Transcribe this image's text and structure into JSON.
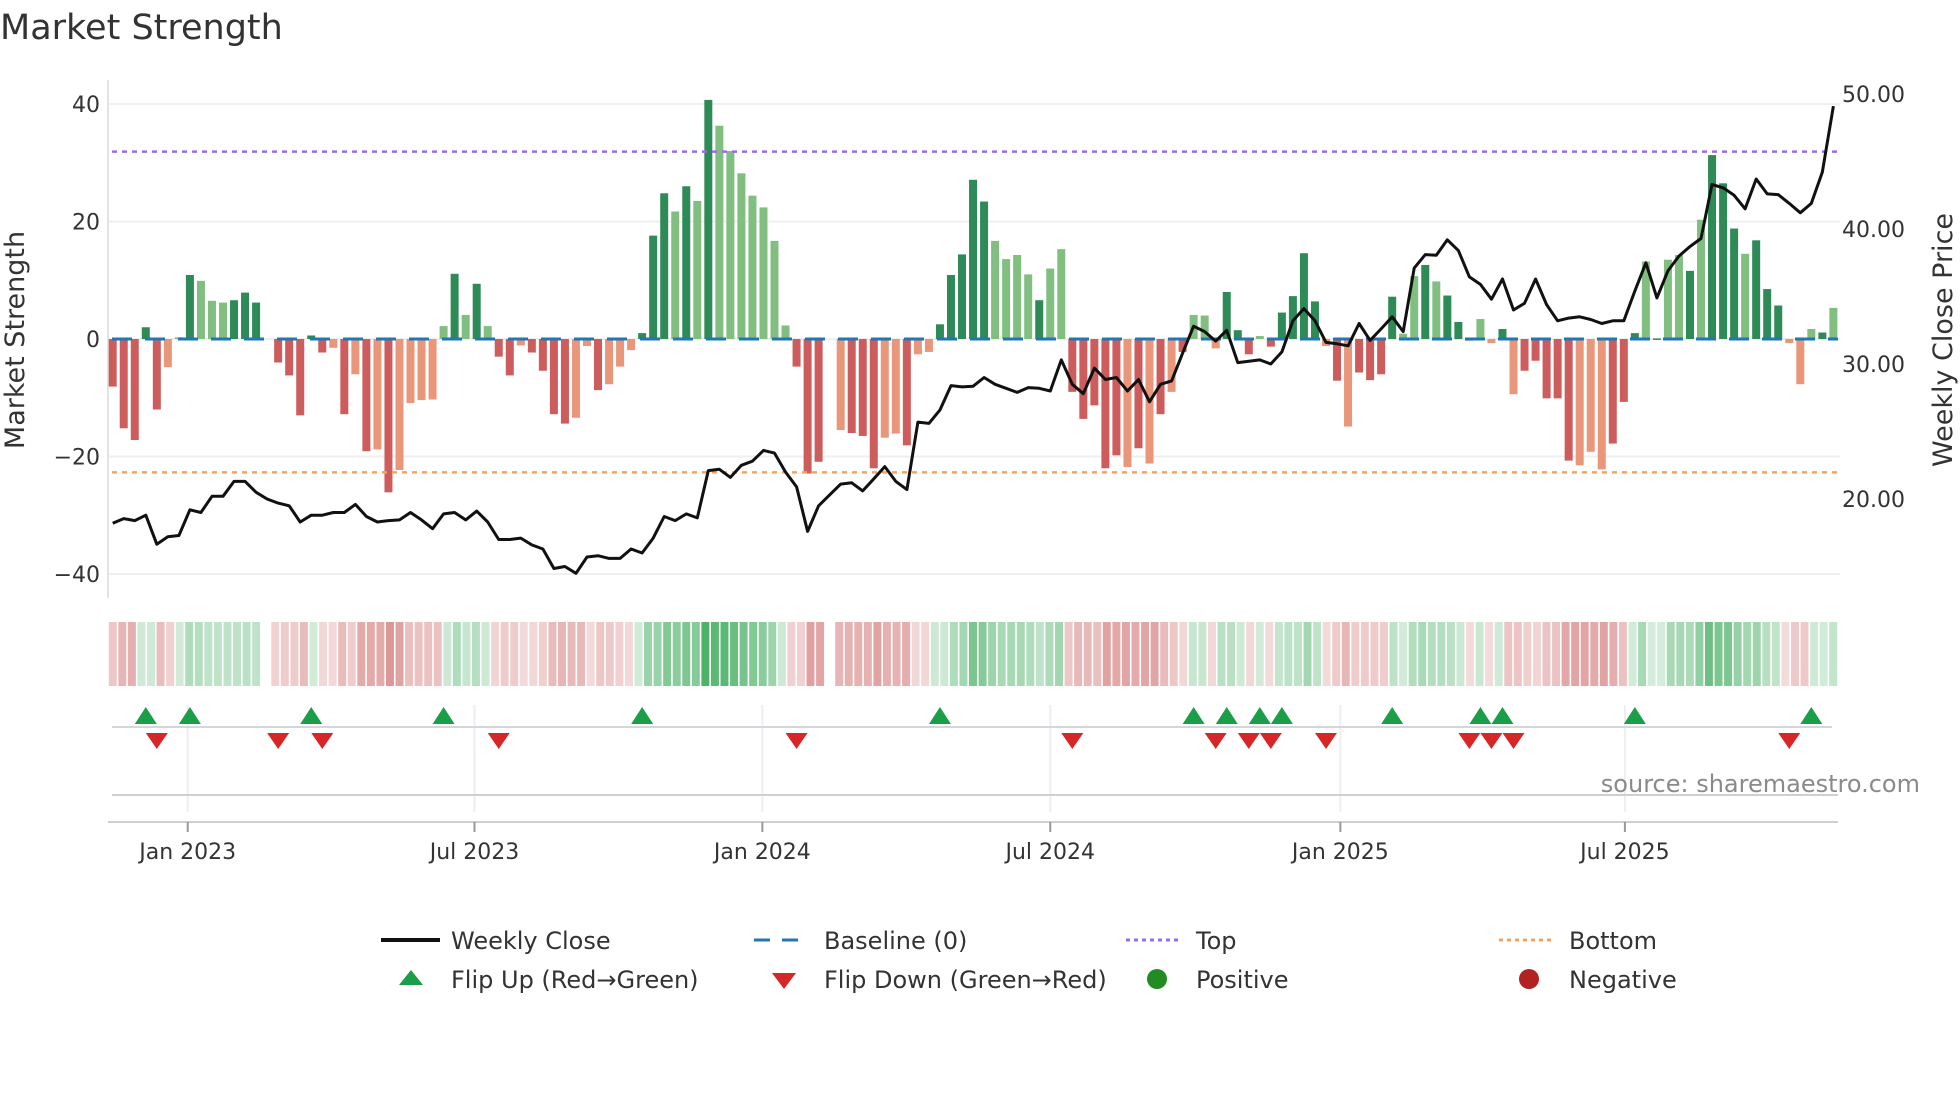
{
  "title": "Market Strength",
  "source": "source: sharemaestro.com",
  "legend": {
    "weekly_close": "Weekly Close",
    "baseline": "Baseline (0)",
    "top": "Top",
    "bottom": "Bottom",
    "flip_up": "Flip Up (Red→Green)",
    "flip_down": "Flip Down (Green→Red)",
    "positive": "Positive",
    "negative": "Negative"
  },
  "colors": {
    "strong_green": "#2e8b57",
    "weak_green": "#80bf80",
    "strong_red": "#cd5c5c",
    "weak_red": "#e9967a",
    "heat_green": "#3caa5a",
    "heat_red": "#cd6464",
    "close_line": "#111111",
    "baseline": "#1f77b4",
    "top": "#9b6ee0",
    "bottom": "#f4a460",
    "flip_up": "#1a9e48",
    "flip_down": "#d62728",
    "positive": "#228b22",
    "negative": "#b22222"
  },
  "chart_data": {
    "type": "bar",
    "title": "Market Strength",
    "ylabel": "Market Strength",
    "y2label": "Weekly Close Price",
    "xlabel": "",
    "ylim": [
      -44,
      44
    ],
    "y2lim": [
      12.6,
      50.9
    ],
    "left_ticks": [
      {
        "value": 40,
        "label": "40"
      },
      {
        "value": 20,
        "label": "20"
      },
      {
        "value": 0,
        "label": "0"
      },
      {
        "value": -20,
        "label": "−20"
      },
      {
        "value": -40,
        "label": "−40"
      }
    ],
    "right_ticks": [
      {
        "value": 50,
        "label": "50.00"
      },
      {
        "value": 40,
        "label": "40.00"
      },
      {
        "value": 30,
        "label": "30.00"
      },
      {
        "value": 20,
        "label": "20.00"
      }
    ],
    "x_ticks": [
      {
        "week": 7.8,
        "label": "Jan 2023"
      },
      {
        "week": 33.8,
        "label": "Jul 2023"
      },
      {
        "week": 59.9,
        "label": "Jan 2024"
      },
      {
        "week": 86.0,
        "label": "Jul 2024"
      },
      {
        "week": 112.3,
        "label": "Jan 2025"
      },
      {
        "week": 138.1,
        "label": "Jul 2025"
      }
    ],
    "top_level": 31.9,
    "bottom_level": -22.7,
    "baseline": 0,
    "strength": [
      -8.1,
      -15.2,
      -17.2,
      2.0,
      -12,
      -4.8,
      0.3,
      10.9,
      9.9,
      6.5,
      6.2,
      6.6,
      7.9,
      6.2,
      0,
      -4,
      -6.2,
      -13,
      0.6,
      -2.3,
      -1.5,
      -12.8,
      -6,
      -19.1,
      -18.8,
      -26.1,
      -22.3,
      -10.9,
      -10.4,
      -10.3,
      2.2,
      11.1,
      4.1,
      9.4,
      2.2,
      -3,
      -6.2,
      -1.1,
      -2.3,
      -5.4,
      -12.8,
      -14.4,
      -13.4,
      -1.2,
      -8.7,
      -7.7,
      -4.7,
      -1.9,
      1.0,
      17.6,
      24.8,
      21.7,
      26,
      23.5,
      40.7,
      36.3,
      32,
      28.2,
      24.4,
      22.4,
      16.7,
      2.3,
      -4.7,
      -22.9,
      -20.9,
      0,
      -15.5,
      -16,
      -16.5,
      -22,
      -16.8,
      -16.1,
      -18.1,
      -2.6,
      -2.2,
      2.5,
      10.9,
      14.4,
      27.1,
      23.4,
      16.7,
      13.6,
      14.3,
      11,
      6.6,
      12,
      15.3,
      -9,
      -13.6,
      -11.3,
      -22,
      -19.8,
      -21.8,
      -18.6,
      -21.2,
      -12.8,
      -9,
      -2.2,
      4.1,
      4.0,
      -1.6,
      8,
      1.5,
      -2.6,
      0.5,
      -1.3,
      4.5,
      7.3,
      14.6,
      6.4,
      -1.2,
      -7.1,
      -14.9,
      -5.7,
      -7,
      -6,
      7.2,
      0.9,
      10.7,
      12.6,
      9.8,
      7.4,
      2.9,
      -0.3,
      3.4,
      -0.7,
      1.7,
      -9.4,
      -5.4,
      -3.7,
      -10.1,
      -10.1,
      -20.7,
      -21.5,
      -19.2,
      -22.2,
      -17.8,
      -10.7,
      1.0,
      13.2,
      0.1,
      13.5,
      14.3,
      11.6,
      20.3,
      31.3,
      26.5,
      18.8,
      14.5,
      16.8,
      8.5,
      5.7,
      -0.7,
      -7.7,
      1.7,
      1.1,
      5.3
    ],
    "shade": "dddddlldllldddldddddldldldllllldldlddlddddlldllldddldldllllllldddlldddlldlldddddlllldlldddddldldldllldddldddddldlddddlldlddllldldddddllldddldlldldddldddllldldllllddddlldd",
    "weekly_close": [
      18.2,
      18.55,
      18.4,
      18.8,
      16.65,
      17.2,
      17.3,
      19.2,
      19.0,
      20.2,
      20.2,
      21.3,
      21.3,
      20.5,
      20.0,
      19.7,
      19.5,
      18.3,
      18.8,
      18.8,
      19.0,
      19.0,
      19.6,
      18.7,
      18.3,
      18.4,
      18.45,
      19.0,
      18.45,
      17.8,
      18.9,
      19.0,
      18.45,
      19.1,
      18.3,
      17.0,
      17.0,
      17.1,
      16.6,
      16.3,
      14.85,
      15.0,
      14.5,
      15.7,
      15.8,
      15.6,
      15.6,
      16.3,
      16.0,
      17.1,
      18.7,
      18.4,
      18.9,
      18.6,
      22.1,
      22.2,
      21.6,
      22.5,
      22.8,
      23.6,
      23.4,
      22.0,
      20.9,
      17.6,
      19.5,
      20.3,
      21.1,
      21.2,
      20.6,
      21.5,
      22.4,
      21.3,
      20.7,
      25.7,
      25.6,
      26.6,
      28.4,
      28.3,
      28.35,
      29.0,
      28.5,
      28.2,
      27.9,
      28.25,
      28.2,
      28.0,
      30.3,
      28.5,
      27.8,
      29.7,
      28.85,
      29.0,
      28.0,
      28.85,
      27.2,
      28.5,
      28.75,
      30.8,
      32.8,
      32.4,
      31.7,
      32.5,
      30.1,
      30.2,
      30.3,
      30.0,
      30.9,
      33.2,
      34.1,
      33.2,
      31.6,
      31.5,
      31.35,
      33.0,
      31.75,
      32.6,
      33.5,
      32.4,
      37.1,
      38.1,
      38.05,
      39.2,
      38.4,
      36.45,
      35.9,
      34.8,
      36.3,
      34.0,
      34.5,
      36.3,
      34.4,
      33.2,
      33.4,
      33.5,
      33.3,
      33.0,
      33.2,
      33.2,
      35.4,
      37.5,
      34.9,
      36.9,
      38.0,
      38.7,
      39.3,
      43.3,
      43.05,
      42.5,
      41.5,
      43.7,
      42.6,
      42.55,
      41.9,
      41.2,
      41.9,
      44.2,
      49.1
    ],
    "flip_up_weeks": [
      4,
      8,
      19,
      31,
      49,
      76,
      99,
      102,
      105,
      107,
      117,
      125,
      127,
      139,
      155
    ],
    "flip_down_weeks": [
      5,
      16,
      20,
      36,
      63,
      88,
      101,
      104,
      106,
      111,
      124,
      126,
      128,
      153
    ],
    "heatmap_columns": 181
  }
}
